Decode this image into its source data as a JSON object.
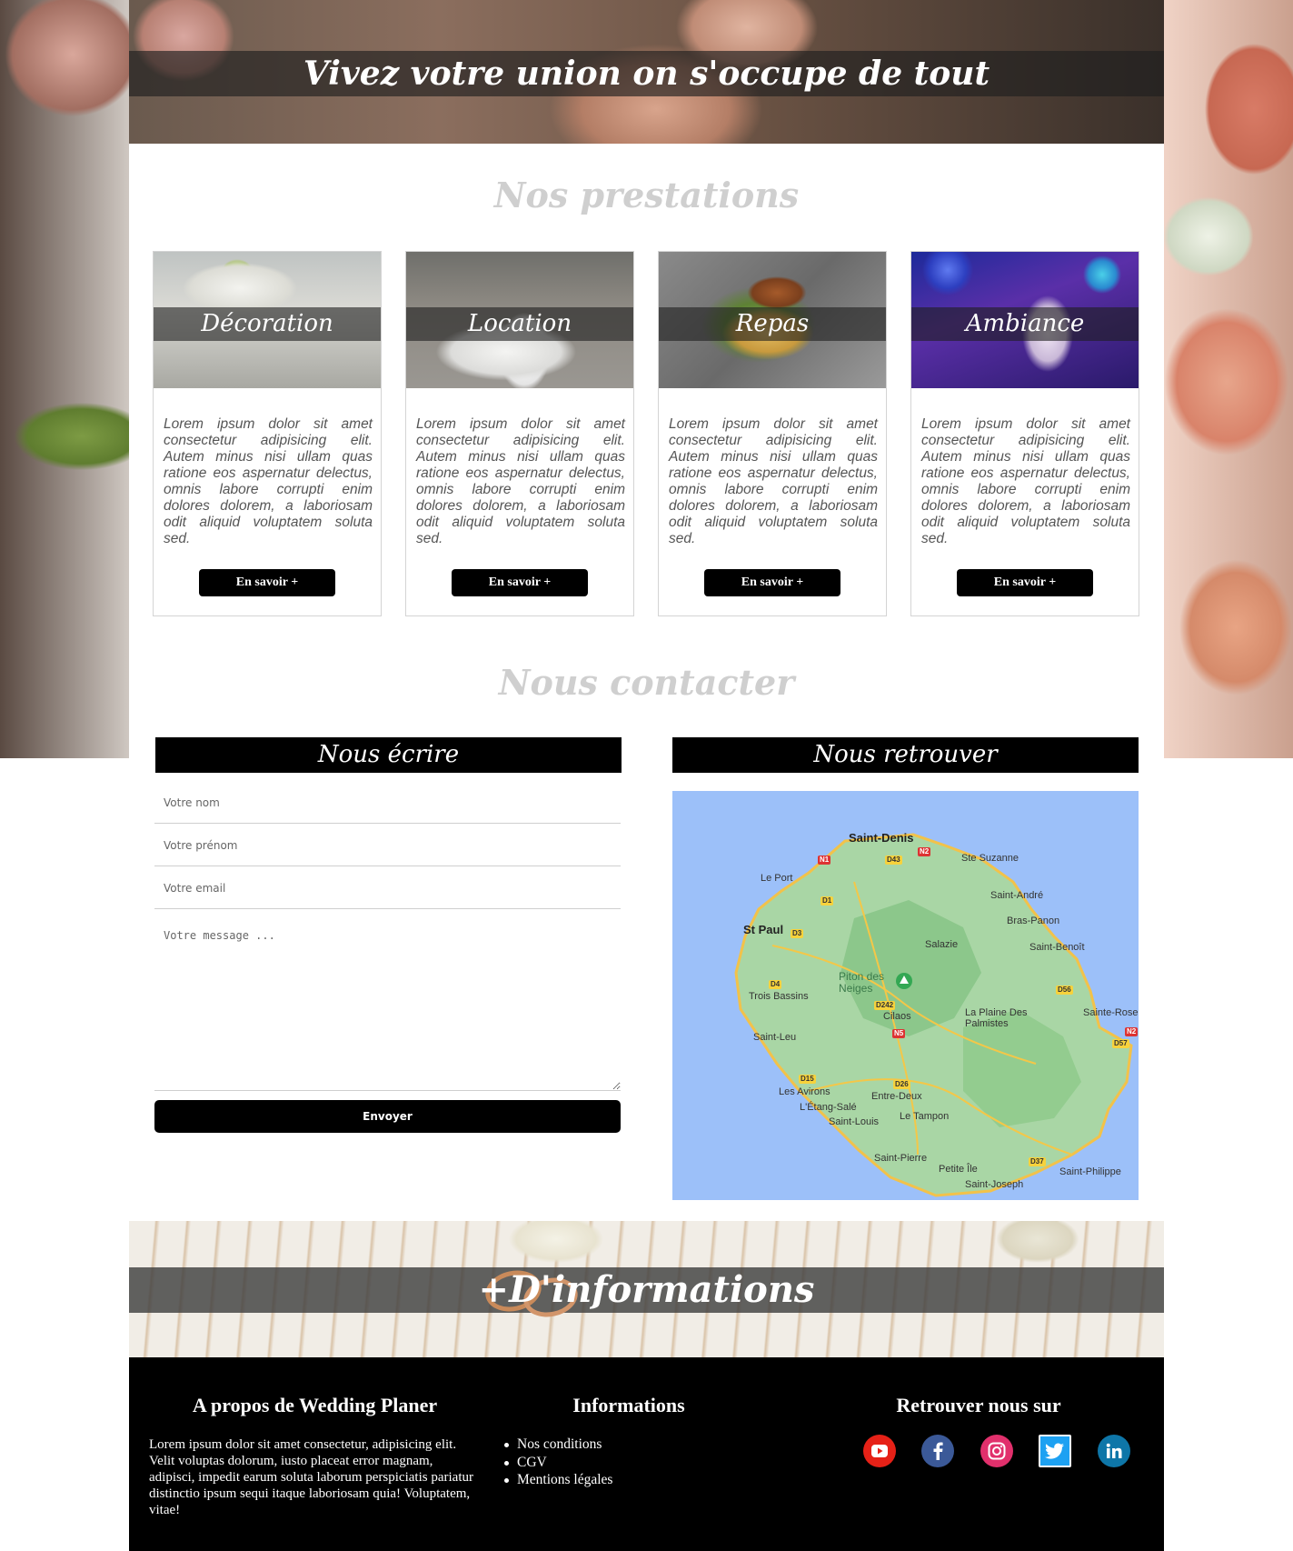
{
  "hero": {
    "title": "Vivez votre union on s'occupe de tout"
  },
  "services": {
    "title": "Nos prestations",
    "button_label": "En savoir +",
    "items": [
      {
        "title": "Décoration",
        "text": "Lorem ipsum dolor sit amet consectetur adipisicing elit. Autem minus nisi ullam quas ratione eos aspernatur delectus, omnis labore corrupti enim dolores dolorem, a laboriosam odit aliquid voluptatem soluta sed.",
        "button": "En savoir +"
      },
      {
        "title": "Location",
        "text": "Lorem ipsum dolor sit amet consectetur adipisicing elit. Autem minus nisi ullam quas ratione eos aspernatur delectus, omnis labore corrupti enim dolores dolorem, a laboriosam odit aliquid voluptatem soluta sed.",
        "button": "En savoir +"
      },
      {
        "title": "Repas",
        "text": "Lorem ipsum dolor sit amet consectetur adipisicing elit. Autem minus nisi ullam quas ratione eos aspernatur delectus, omnis labore corrupti enim dolores dolorem, a laboriosam odit aliquid voluptatem soluta sed.",
        "button": "En savoir +"
      },
      {
        "title": "Ambiance",
        "text": "Lorem ipsum dolor sit amet consectetur adipisicing elit. Autem minus nisi ullam quas ratione eos aspernatur delectus, omnis labore corrupti enim dolores dolorem, a laboriosam odit aliquid voluptatem soluta sed.",
        "button": "En savoir +"
      }
    ]
  },
  "contact": {
    "title": "Nous contacter",
    "write_title": "Nous écrire",
    "find_title": "Nous retrouver",
    "name_placeholder": "Votre nom",
    "firstname_placeholder": "Votre prénom",
    "email_placeholder": "Votre email",
    "message_placeholder": "Votre message ...",
    "send_label": "Envoyer"
  },
  "map": {
    "places": {
      "saint_denis": "Saint-Denis",
      "ste_suzanne": "Ste Suzanne",
      "le_port": "Le Port",
      "saint_andre": "Saint-André",
      "bras_panon": "Bras-Panon",
      "st_paul": "St Paul",
      "salazie": "Salazie",
      "saint_benoit": "Saint-Benoît",
      "piton": "Piton des Neiges",
      "trois_bassins": "Trois Bassins",
      "cilaos": "Cilaos",
      "la_plaine": "La Plaine Des Palmistes",
      "saint_rose": "Sainte-Rose",
      "saint_leu": "Saint-Leu",
      "les_avirons": "Les Avirons",
      "entre_deux": "Entre-Deux",
      "etang_sale": "L'Étang-Salé",
      "saint_louis": "Saint-Louis",
      "le_tampon": "Le Tampon",
      "saint_pierre": "Saint-Pierre",
      "petite_ile": "Petite Île",
      "saint_philippe": "Saint-Philippe",
      "saint_joseph": "Saint-Joseph"
    },
    "roads": {
      "n1": "N1",
      "n2": "N2",
      "d43": "D43",
      "d1": "D1",
      "d3": "D3",
      "d4": "D4",
      "d242": "D242",
      "n5": "N5",
      "d56": "D56",
      "d57": "D57",
      "d15": "D15",
      "d26": "D26",
      "d37": "D37",
      "n2b": "N2"
    }
  },
  "info_banner": {
    "title": "+D'informations"
  },
  "footer": {
    "about_title": "A propos de Wedding Planer",
    "about_text": "Lorem ipsum dolor sit amet consectetur, adipisicing elit. Velit voluptas dolorum, iusto placeat error magnam, adipisci, impedit earum soluta laborum perspiciatis pariatur distinctio ipsum sequi itaque laboriosam quia! Voluptatem, vitae!",
    "info_title": "Informations",
    "links": [
      "Nos conditions",
      "CGV",
      "Mentions légales"
    ],
    "social_title": "Retrouver nous sur",
    "social": [
      {
        "name": "youtube",
        "color": "#e62117"
      },
      {
        "name": "facebook",
        "color": "#3b5998"
      },
      {
        "name": "instagram",
        "color": "#e1306c"
      },
      {
        "name": "twitter",
        "color": "#1da1f2"
      },
      {
        "name": "linkedin",
        "color": "#0e76a8"
      }
    ]
  }
}
